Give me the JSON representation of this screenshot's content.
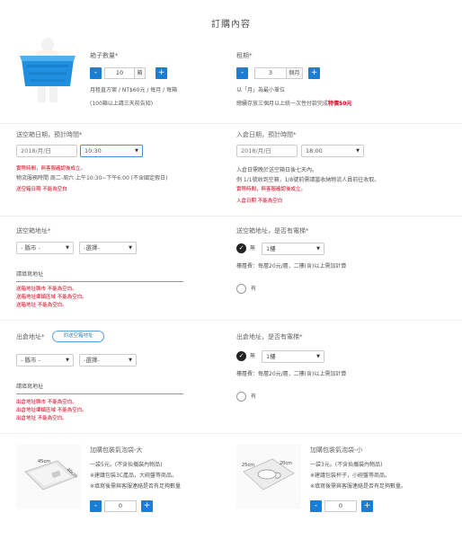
{
  "page": {
    "title": "訂購內容"
  },
  "box": {
    "label": "箱子數量*",
    "qty": "10",
    "unit": "箱",
    "price_note": "月租直方案 / NT$60元 / 每月 / 每箱",
    "bulk_note": "(100箱以上請三天前告知)"
  },
  "period": {
    "label": "租期*",
    "qty": "3",
    "unit": "個月",
    "unit_note": "以「月」為最小單位",
    "discount_note_prefix": "總續存放三個月以上統一次性付款完成",
    "discount_note_highlight": "特價50元"
  },
  "delivery_empty": {
    "label": "送空箱日期，預計時間*",
    "date_placeholder": "2018/月/日",
    "time_value": "10:30",
    "warn1": "實際時間，與客服確認後成立。",
    "note1": "物流服務時間 周二-周六 上午10:30~下午6:00 (不含國定假日)",
    "error1": "送空箱日期 不能為空白"
  },
  "pickup": {
    "label": "入倉日期，預計時間*",
    "date_placeholder": "2018/月/日",
    "time_value": "18:00",
    "note1": "入倉日需晚於送空箱日後七天內。",
    "note2": "例 1/1號收到空箱，1/8號前需請當收納物流人員前往收取。",
    "warn1": "實際時間，與客服確認後成立。",
    "error1": "入倉日期 不能為空白"
  },
  "address_empty": {
    "label": "送空箱地址*",
    "city_placeholder": "- 縣市 -",
    "district_placeholder": "-選擇-",
    "detail_placeholder": "請填寫地址",
    "errors": [
      "送箱地址縣市 不能為空白。",
      "送箱地址鄉鎮區域 不能為空白。",
      "送箱地址 不能為空白。"
    ]
  },
  "elevator_empty": {
    "label": "送空箱地址，是否有電梯*",
    "opt_no": "無",
    "floor_value": "1樓",
    "floor_note": "樓層費：每層20元/層，二樓(含)以上需加計算",
    "opt_yes": "有"
  },
  "address_out": {
    "label": "出倉地址*",
    "same_button": "同送空箱地址",
    "city_placeholder": "- 縣市 -",
    "district_placeholder": "-選擇-",
    "detail_placeholder": "請填寫地址",
    "errors": [
      "出倉地址縣市 不能為空白。",
      "出倉地址鄉鎮區域 不能為空白。",
      "出倉地址 不能為空白。"
    ]
  },
  "elevator_out": {
    "label": "出倉地址，是否有電梯*",
    "opt_no": "無",
    "floor_value": "1樓",
    "floor_note": "樓層費：每層20元/層，二樓(含)以上需加計算",
    "opt_yes": "有"
  },
  "addon_large": {
    "title": "加購包裝氣泡袋-大",
    "price": "一袋5元。(不含抬攜裝內物品)",
    "note1": "※建議包裝3C產品，大碗盤等商品。",
    "note2": "※填寫後需與客服連絡是否有足夠數量",
    "qty": "0",
    "img_w": "45cm",
    "img_h": "40cm"
  },
  "addon_small": {
    "title": "加購包裝氣泡袋-小",
    "price": "一袋3元。(不含抬攜裝內物品)",
    "note1": "※建議包裝杯子，小碗盤等商品。",
    "note2": "※填寫後需與客服連絡是否有足夠數量。",
    "qty": "0",
    "img_w": "25cm",
    "img_h": "20cm"
  },
  "controls": {
    "minus": "-",
    "plus": "+",
    "caret": "▼",
    "check": "✓"
  },
  "colors": {
    "accent": "#1a7fd4",
    "error": "#d0021b"
  }
}
